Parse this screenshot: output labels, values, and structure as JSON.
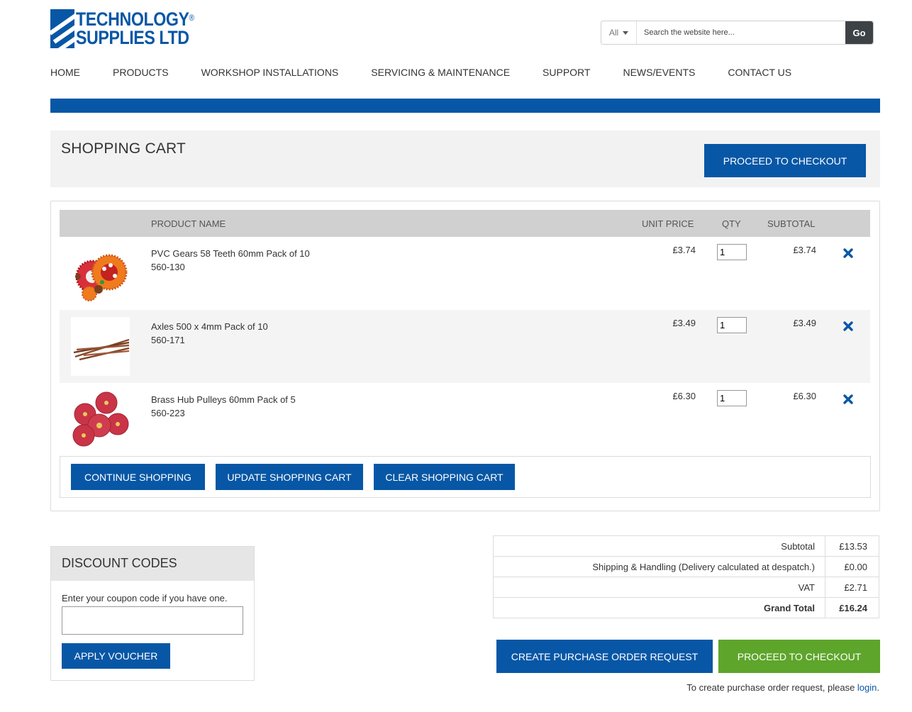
{
  "header": {
    "logo_line1": "TECHNOLOGY",
    "logo_line2": "SUPPLIES LTD",
    "logo_reg": "®",
    "search": {
      "scope": "All",
      "placeholder": "Search the website here...",
      "go_label": "Go"
    },
    "nav": [
      "HOME",
      "PRODUCTS",
      "WORKSHOP INSTALLATIONS",
      "SERVICING & MAINTENANCE",
      "SUPPORT",
      "NEWS/EVENTS",
      "CONTACT US"
    ]
  },
  "cart": {
    "title": "SHOPPING CART",
    "checkout_top_label": "PROCEED TO CHECKOUT",
    "columns": {
      "product_name": "PRODUCT NAME",
      "unit_price": "UNIT PRICE",
      "qty": "QTY",
      "subtotal": "SUBTOTAL"
    },
    "items": [
      {
        "name": "PVC Gears 58 Teeth 60mm Pack of 10",
        "sku": "560-130",
        "unit_price": "£3.74",
        "qty": "1",
        "subtotal": "£3.74"
      },
      {
        "name": "Axles 500 x 4mm Pack of 10",
        "sku": "560-171",
        "unit_price": "£3.49",
        "qty": "1",
        "subtotal": "£3.49"
      },
      {
        "name": "Brass Hub Pulleys 60mm Pack of 5",
        "sku": "560-223",
        "unit_price": "£6.30",
        "qty": "1",
        "subtotal": "£6.30"
      }
    ],
    "continue_label": "CONTINUE SHOPPING",
    "update_label": "UPDATE SHOPPING CART",
    "clear_label": "CLEAR SHOPPING CART"
  },
  "discount": {
    "title": "DISCOUNT CODES",
    "prompt": "Enter your coupon code if you have one.",
    "input_value": "",
    "apply_label": "APPLY VOUCHER"
  },
  "totals": {
    "subtotal_label": "Subtotal",
    "subtotal_value": "£13.53",
    "shipping_label": "Shipping & Handling (Delivery calculated at despatch.)",
    "shipping_value": "£0.00",
    "vat_label": "VAT",
    "vat_value": "£2.71",
    "grand_label": "Grand Total",
    "grand_value": "£16.24"
  },
  "bottom": {
    "po_label": "CREATE PURCHASE ORDER REQUEST",
    "checkout_label": "PROCEED TO CHECKOUT",
    "po_note_text": "To create purchase order request, please ",
    "po_note_link": "login",
    "po_note_end": "."
  },
  "colors": {
    "brand_blue": "#0757a6",
    "checkout_green": "#5ea52b"
  },
  "icons": {
    "remove": "close-x-icon",
    "search_scope": "chevron-down-icon"
  }
}
